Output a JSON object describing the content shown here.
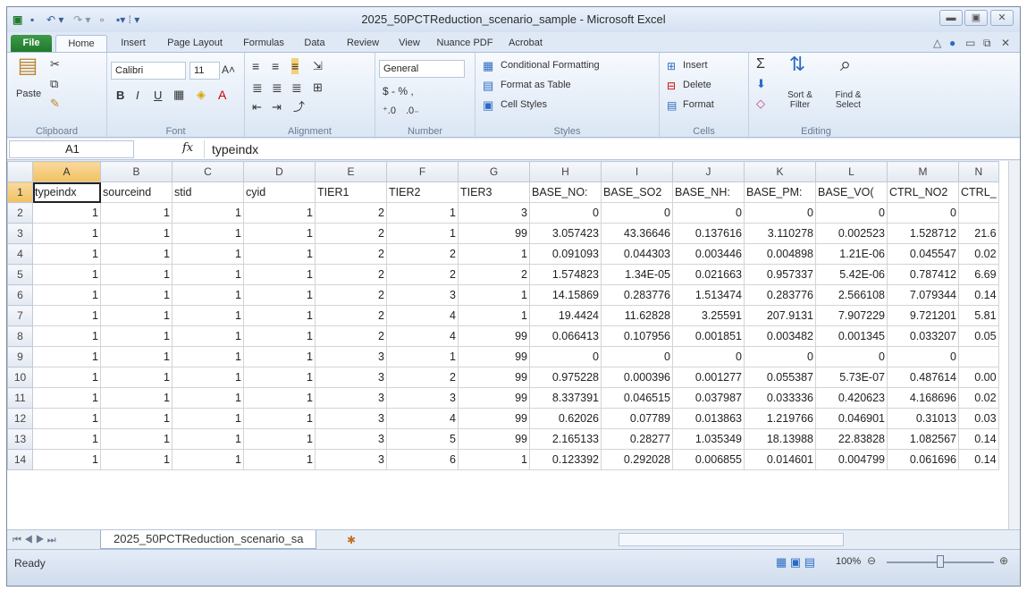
{
  "window": {
    "title": "2025_50PCTReduction_scenario_sample  -  Microsoft Excel"
  },
  "ribbon_tabs": [
    "File",
    "Home",
    "Insert",
    "Page Layout",
    "Formulas",
    "Data",
    "Review",
    "View",
    "Nuance PDF",
    "Acrobat"
  ],
  "clipboard": {
    "paste": "Paste",
    "label": "Clipboard"
  },
  "font": {
    "name": "Calibri",
    "size": "11",
    "label": "Font",
    "bold": "B",
    "italic": "I",
    "underline": "U"
  },
  "alignment": {
    "label": "Alignment"
  },
  "number": {
    "format": "General",
    "currency": "$ - %  ,",
    "label": "Number"
  },
  "styles": {
    "conditional": "Conditional Formatting",
    "table": "Format as Table",
    "cell": "Cell Styles",
    "label": "Styles"
  },
  "cells": {
    "insert": "Insert",
    "delete": "Delete",
    "format": "Format",
    "label": "Cells"
  },
  "editing": {
    "sort": "Sort & Filter",
    "find": "Find & Select",
    "label": "Editing"
  },
  "formula_bar": {
    "name_box": "A1",
    "fx": "fx",
    "formula": "typeindx"
  },
  "columns": [
    "A",
    "B",
    "C",
    "D",
    "E",
    "F",
    "G",
    "H",
    "I",
    "J",
    "K",
    "L",
    "M",
    "N"
  ],
  "rows": [
    [
      "typeindx",
      "sourceind",
      "stid",
      "cyid",
      "TIER1",
      "TIER2",
      "TIER3",
      "BASE_NO:",
      "BASE_SO2",
      "BASE_NH:",
      "BASE_PM:",
      "BASE_VO(",
      "CTRL_NO2",
      "CTRL_"
    ],
    [
      "1",
      "1",
      "1",
      "1",
      "2",
      "1",
      "3",
      "0",
      "0",
      "0",
      "0",
      "0",
      "0",
      ""
    ],
    [
      "1",
      "1",
      "1",
      "1",
      "2",
      "1",
      "99",
      "3.057423",
      "43.36646",
      "0.137616",
      "3.110278",
      "0.002523",
      "1.528712",
      "21.6"
    ],
    [
      "1",
      "1",
      "1",
      "1",
      "2",
      "2",
      "1",
      "0.091093",
      "0.044303",
      "0.003446",
      "0.004898",
      "1.21E-06",
      "0.045547",
      "0.02"
    ],
    [
      "1",
      "1",
      "1",
      "1",
      "2",
      "2",
      "2",
      "1.574823",
      "1.34E-05",
      "0.021663",
      "0.957337",
      "5.42E-06",
      "0.787412",
      "6.69"
    ],
    [
      "1",
      "1",
      "1",
      "1",
      "2",
      "3",
      "1",
      "14.15869",
      "0.283776",
      "1.513474",
      "0.283776",
      "2.566108",
      "7.079344",
      "0.14"
    ],
    [
      "1",
      "1",
      "1",
      "1",
      "2",
      "4",
      "1",
      "19.4424",
      "11.62828",
      "3.25591",
      "207.9131",
      "7.907229",
      "9.721201",
      "5.81"
    ],
    [
      "1",
      "1",
      "1",
      "1",
      "2",
      "4",
      "99",
      "0.066413",
      "0.107956",
      "0.001851",
      "0.003482",
      "0.001345",
      "0.033207",
      "0.05"
    ],
    [
      "1",
      "1",
      "1",
      "1",
      "3",
      "1",
      "99",
      "0",
      "0",
      "0",
      "0",
      "0",
      "0",
      ""
    ],
    [
      "1",
      "1",
      "1",
      "1",
      "3",
      "2",
      "99",
      "0.975228",
      "0.000396",
      "0.001277",
      "0.055387",
      "5.73E-07",
      "0.487614",
      "0.00"
    ],
    [
      "1",
      "1",
      "1",
      "1",
      "3",
      "3",
      "99",
      "8.337391",
      "0.046515",
      "0.037987",
      "0.033336",
      "0.420623",
      "4.168696",
      "0.02"
    ],
    [
      "1",
      "1",
      "1",
      "1",
      "3",
      "4",
      "99",
      "0.62026",
      "0.07789",
      "0.013863",
      "1.219766",
      "0.046901",
      "0.31013",
      "0.03"
    ],
    [
      "1",
      "1",
      "1",
      "1",
      "3",
      "5",
      "99",
      "2.165133",
      "0.28277",
      "1.035349",
      "18.13988",
      "22.83828",
      "1.082567",
      "0.14"
    ],
    [
      "1",
      "1",
      "1",
      "1",
      "3",
      "6",
      "1",
      "0.123392",
      "0.292028",
      "0.006855",
      "0.014601",
      "0.004799",
      "0.061696",
      "0.14"
    ]
  ],
  "sheet": {
    "tab": "2025_50PCTReduction_scenario_sa"
  },
  "status": {
    "ready": "Ready",
    "zoom": "100%"
  }
}
